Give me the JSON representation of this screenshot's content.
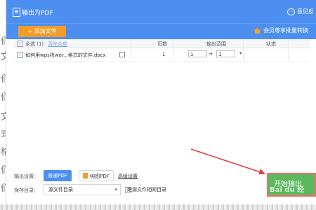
{
  "window": {
    "title": "输出为PDF",
    "feedback_label": "意见反",
    "icons": {
      "title": "pdf-doc-icon",
      "feedback": "feedback-icon"
    }
  },
  "toolbar": {
    "add_button_label": "+ 添加文件",
    "vip_promo": "会员尊享批量转换",
    "vip_icon": "vip-crown-icon",
    "accent_color": "#4d8ff0",
    "add_button_color": "#f39c2a"
  },
  "table": {
    "select_all": "全选 (1)",
    "clear_list": "清除全部",
    "headers": {
      "pages": "页数",
      "range": "输出范围",
      "status": "状态"
    },
    "rows": [
      {
        "checked": true,
        "filename": "如何用wps将wor...格式的文件.docx",
        "pages": "1",
        "range_from": "1",
        "range_to": "1"
      }
    ]
  },
  "settings": {
    "output_label": "输出设置：",
    "mode_normal": "普通PDF",
    "mode_pure": "纯图PDF",
    "advanced": "高级设置",
    "save_label": "保存目录：",
    "directory_value": "源文件目录",
    "same_dir_label": "跟源文件相同目录"
  },
  "actions": {
    "start_label": "开始输出",
    "start_color": "#5cb85c",
    "highlight_color": "#ff6b6b"
  },
  "overlay": {
    "watermark": "Bai du 经"
  },
  "background_text": [
    "们",
    "文",
    "们",
    "们",
    "文",
    "式",
    "格",
    "们",
    "们"
  ]
}
